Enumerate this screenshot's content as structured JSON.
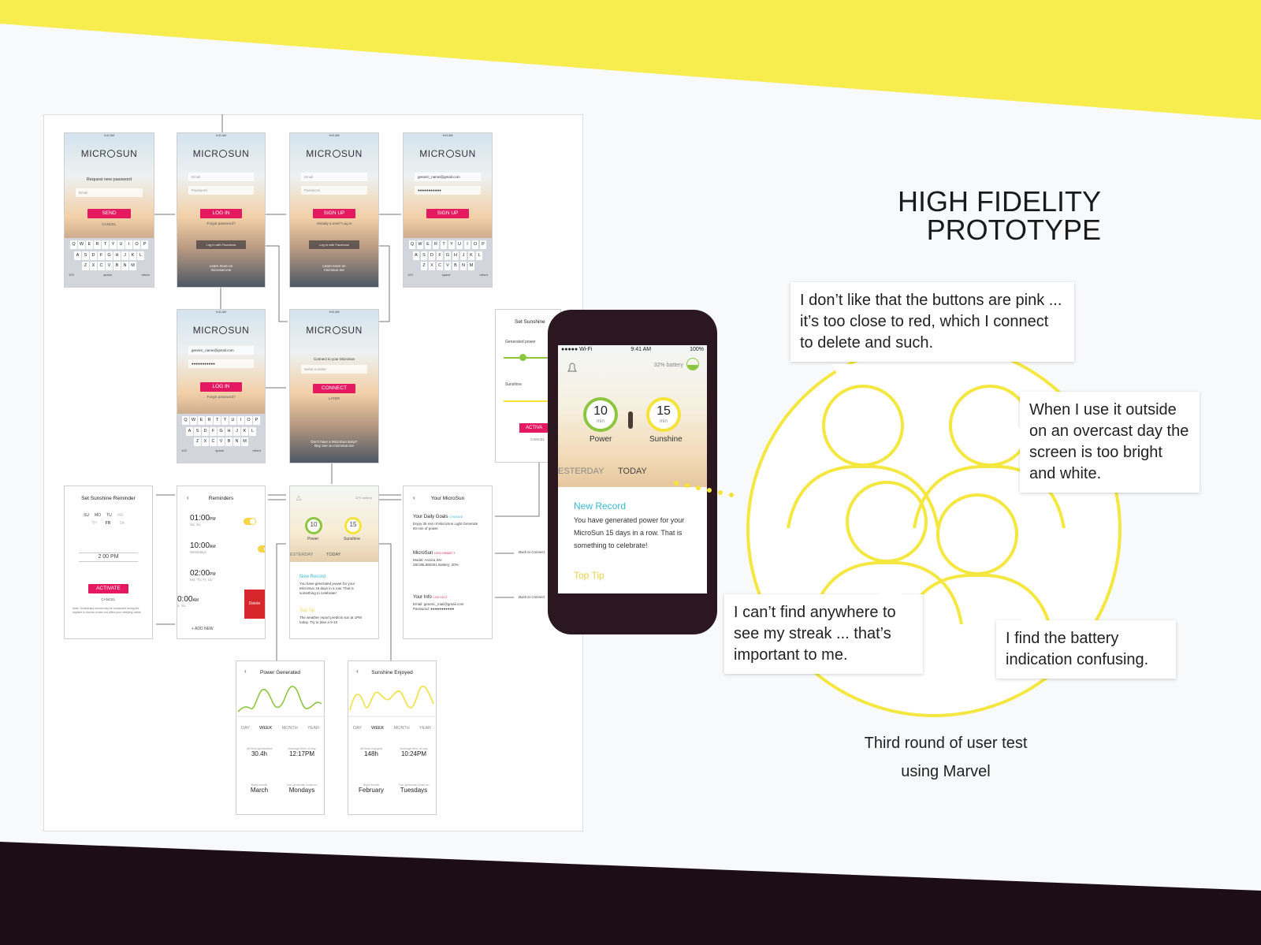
{
  "title": {
    "line1": "HIGH FIDELITY",
    "line2": "PROTOTYPE"
  },
  "caption": {
    "line1": "Third round of user test",
    "line2": "using Marvel"
  },
  "quotes": {
    "q1": "I don’t like that the buttons are pink ... it’s too close to red, which I connect to delete and such.",
    "q2": "When I use it outside on an overcast day the screen is too bright and white.",
    "q3": "I can’t find anywhere to see my streak ... that’s important to me.",
    "q4": "I find the battery indication confusing."
  },
  "colors": {
    "accent_yellow": "#f7ed4e",
    "dark": "#1d0d14",
    "pink": "#e5195f",
    "teal": "#3ab8d4"
  },
  "brand": {
    "pre": "MICR",
    "post": "SUN"
  },
  "status": {
    "time": "9:41 AM",
    "carrier": "●●●●● Wi-Fi",
    "battery": "100%"
  },
  "screens": {
    "forgot": {
      "prompt": "Request new password",
      "email": "Email",
      "button": "SEND",
      "cancel": "CANCEL"
    },
    "login": {
      "email": "Email",
      "password": "Password",
      "button": "LOG IN",
      "forgot": "Forgot password?",
      "facebook": "Log in with Facebook",
      "learn": "Learn more on microsun.me"
    },
    "signup": {
      "email": "Email",
      "password": "Password",
      "button": "SIGN UP",
      "already": "Already a user? Log in",
      "facebook": "Log in with Facebook",
      "learn": "Learn more on microsun.me"
    },
    "signup_filled": {
      "email": "generic_name@gmail.com",
      "password": "●●●●●●●●●●●",
      "button": "SIGN UP"
    },
    "login_filled": {
      "email": "generic_name@gmail.com",
      "password": "●●●●●●●●●●●",
      "button": "LOG IN",
      "forgot": "Forgot password?"
    },
    "connect": {
      "prompt": "Connect to your MicroSun",
      "serial": "Serial number",
      "button": "CONNECT",
      "later": "LATER",
      "footer": "Don't have a MicroSun lamp? Buy one on microsun.me"
    },
    "keyboard": {
      "row1": [
        "Q",
        "W",
        "E",
        "R",
        "T",
        "Y",
        "U",
        "I",
        "O",
        "P"
      ],
      "row2": [
        "A",
        "S",
        "D",
        "F",
        "G",
        "H",
        "J",
        "K",
        "L"
      ],
      "row3": [
        "Z",
        "X",
        "C",
        "V",
        "B",
        "N",
        "M"
      ],
      "num": "123",
      "space": "space",
      "ret": "return"
    },
    "reminder": {
      "title": "Set Sunshine Reminder",
      "days1": [
        "SU",
        "MO",
        "TU",
        "WE"
      ],
      "days2": [
        "TH",
        "FR",
        "SA"
      ],
      "time": "2 00  PM",
      "button": "ACTIVATE",
      "cancel": "CANCEL",
      "note": "Note: Suntherapy should only be conducted during the daytime to ensure it does not affect your sleeping habits."
    },
    "reminders": {
      "title": "Reminders",
      "items": [
        {
          "time": "01:00",
          "ampm": "PM",
          "days": "Sa, Su"
        },
        {
          "time": "10:00",
          "ampm": "AM",
          "days": "Weekdays"
        },
        {
          "time": "02:00",
          "ampm": "PM",
          "days": "Mo, Tu, Fr, Su"
        },
        {
          "time": "0:00",
          "ampm": "AM",
          "days": "a, Su"
        }
      ],
      "delete": "Delete",
      "add": "+ ADD NEW"
    },
    "home_small": {
      "battery": "32% battery",
      "power": "10",
      "sunshine": "15",
      "unit": "min",
      "power_label": "Power",
      "sunshine_label": "Sunshine",
      "tab_prev": "ESTERDAY",
      "tab_today": "TODAY",
      "record_title": "New Record",
      "record_text": "You have generated power for your MicroSun 15 days in a row. That is something to celebrate!",
      "tip_title": "Top Tip",
      "tip_text": "The weather report predicts sun at 1PM today. Try to plan a 5-10"
    },
    "my_microsun": {
      "title": "Your MicroSun",
      "goals_title": "Your Daily Goals",
      "goals_action": "CHANGE",
      "goals_text": "Enjoy 35 min of MicroSun Light Generate 60 min of power",
      "device_title": "MicroSun",
      "device_action": "DISCONNECT",
      "device_text": "Model: Arctica SN: 28C95L880301 Battery: 20%",
      "info_title": "Your Info",
      "info_action": "LOG OUT",
      "info_text": "Email: generic_mail@gmail.com Password: ●●●●●●●●●●●",
      "back": "Back to Connect"
    },
    "power": {
      "title": "Power Generated",
      "tabs": [
        "DAY",
        "WEEK",
        "MONTH",
        "YEAR"
      ],
      "s1l": "All time generated",
      "s1v": "30.4h",
      "s2l": "Average time of day",
      "s2v": "12:17PM",
      "s3l": "Best month",
      "s3v": "March",
      "s4l": "You generate most on",
      "s4v": "Mondays"
    },
    "sunshine": {
      "title": "Sunshine Enjoyed",
      "tabs": [
        "DAY",
        "WEEK",
        "MONTH",
        "YEAR"
      ],
      "s1l": "All time enjoyed",
      "s1v": "148h",
      "s2l": "Average time of day",
      "s2v": "10:24PM",
      "s3l": "Best month",
      "s3v": "February",
      "s4l": "You generate most on",
      "s4v": "Tuesdays"
    },
    "settings_partial": {
      "title": "Set Sunshine",
      "gen": "Generated power",
      "sun": "Sunshine",
      "button": "ACTIVA",
      "cancel": "CANCEL"
    }
  },
  "big_phone": {
    "status_left": "●●●●● Wi-Fi",
    "status_time": "9:41 AM",
    "status_right": "100%",
    "battery": "32% battery",
    "power": "10",
    "sunshine": "15",
    "unit": "min",
    "power_label": "Power",
    "sunshine_label": "Sunshine",
    "tab_prev": "ESTERDAY",
    "tab_today": "TODAY",
    "record_title": "New Record",
    "record_text": "You have generated power for your MicroSun 15 days in a row. That is something to celebrate!",
    "tip_title": "Top Tip"
  }
}
